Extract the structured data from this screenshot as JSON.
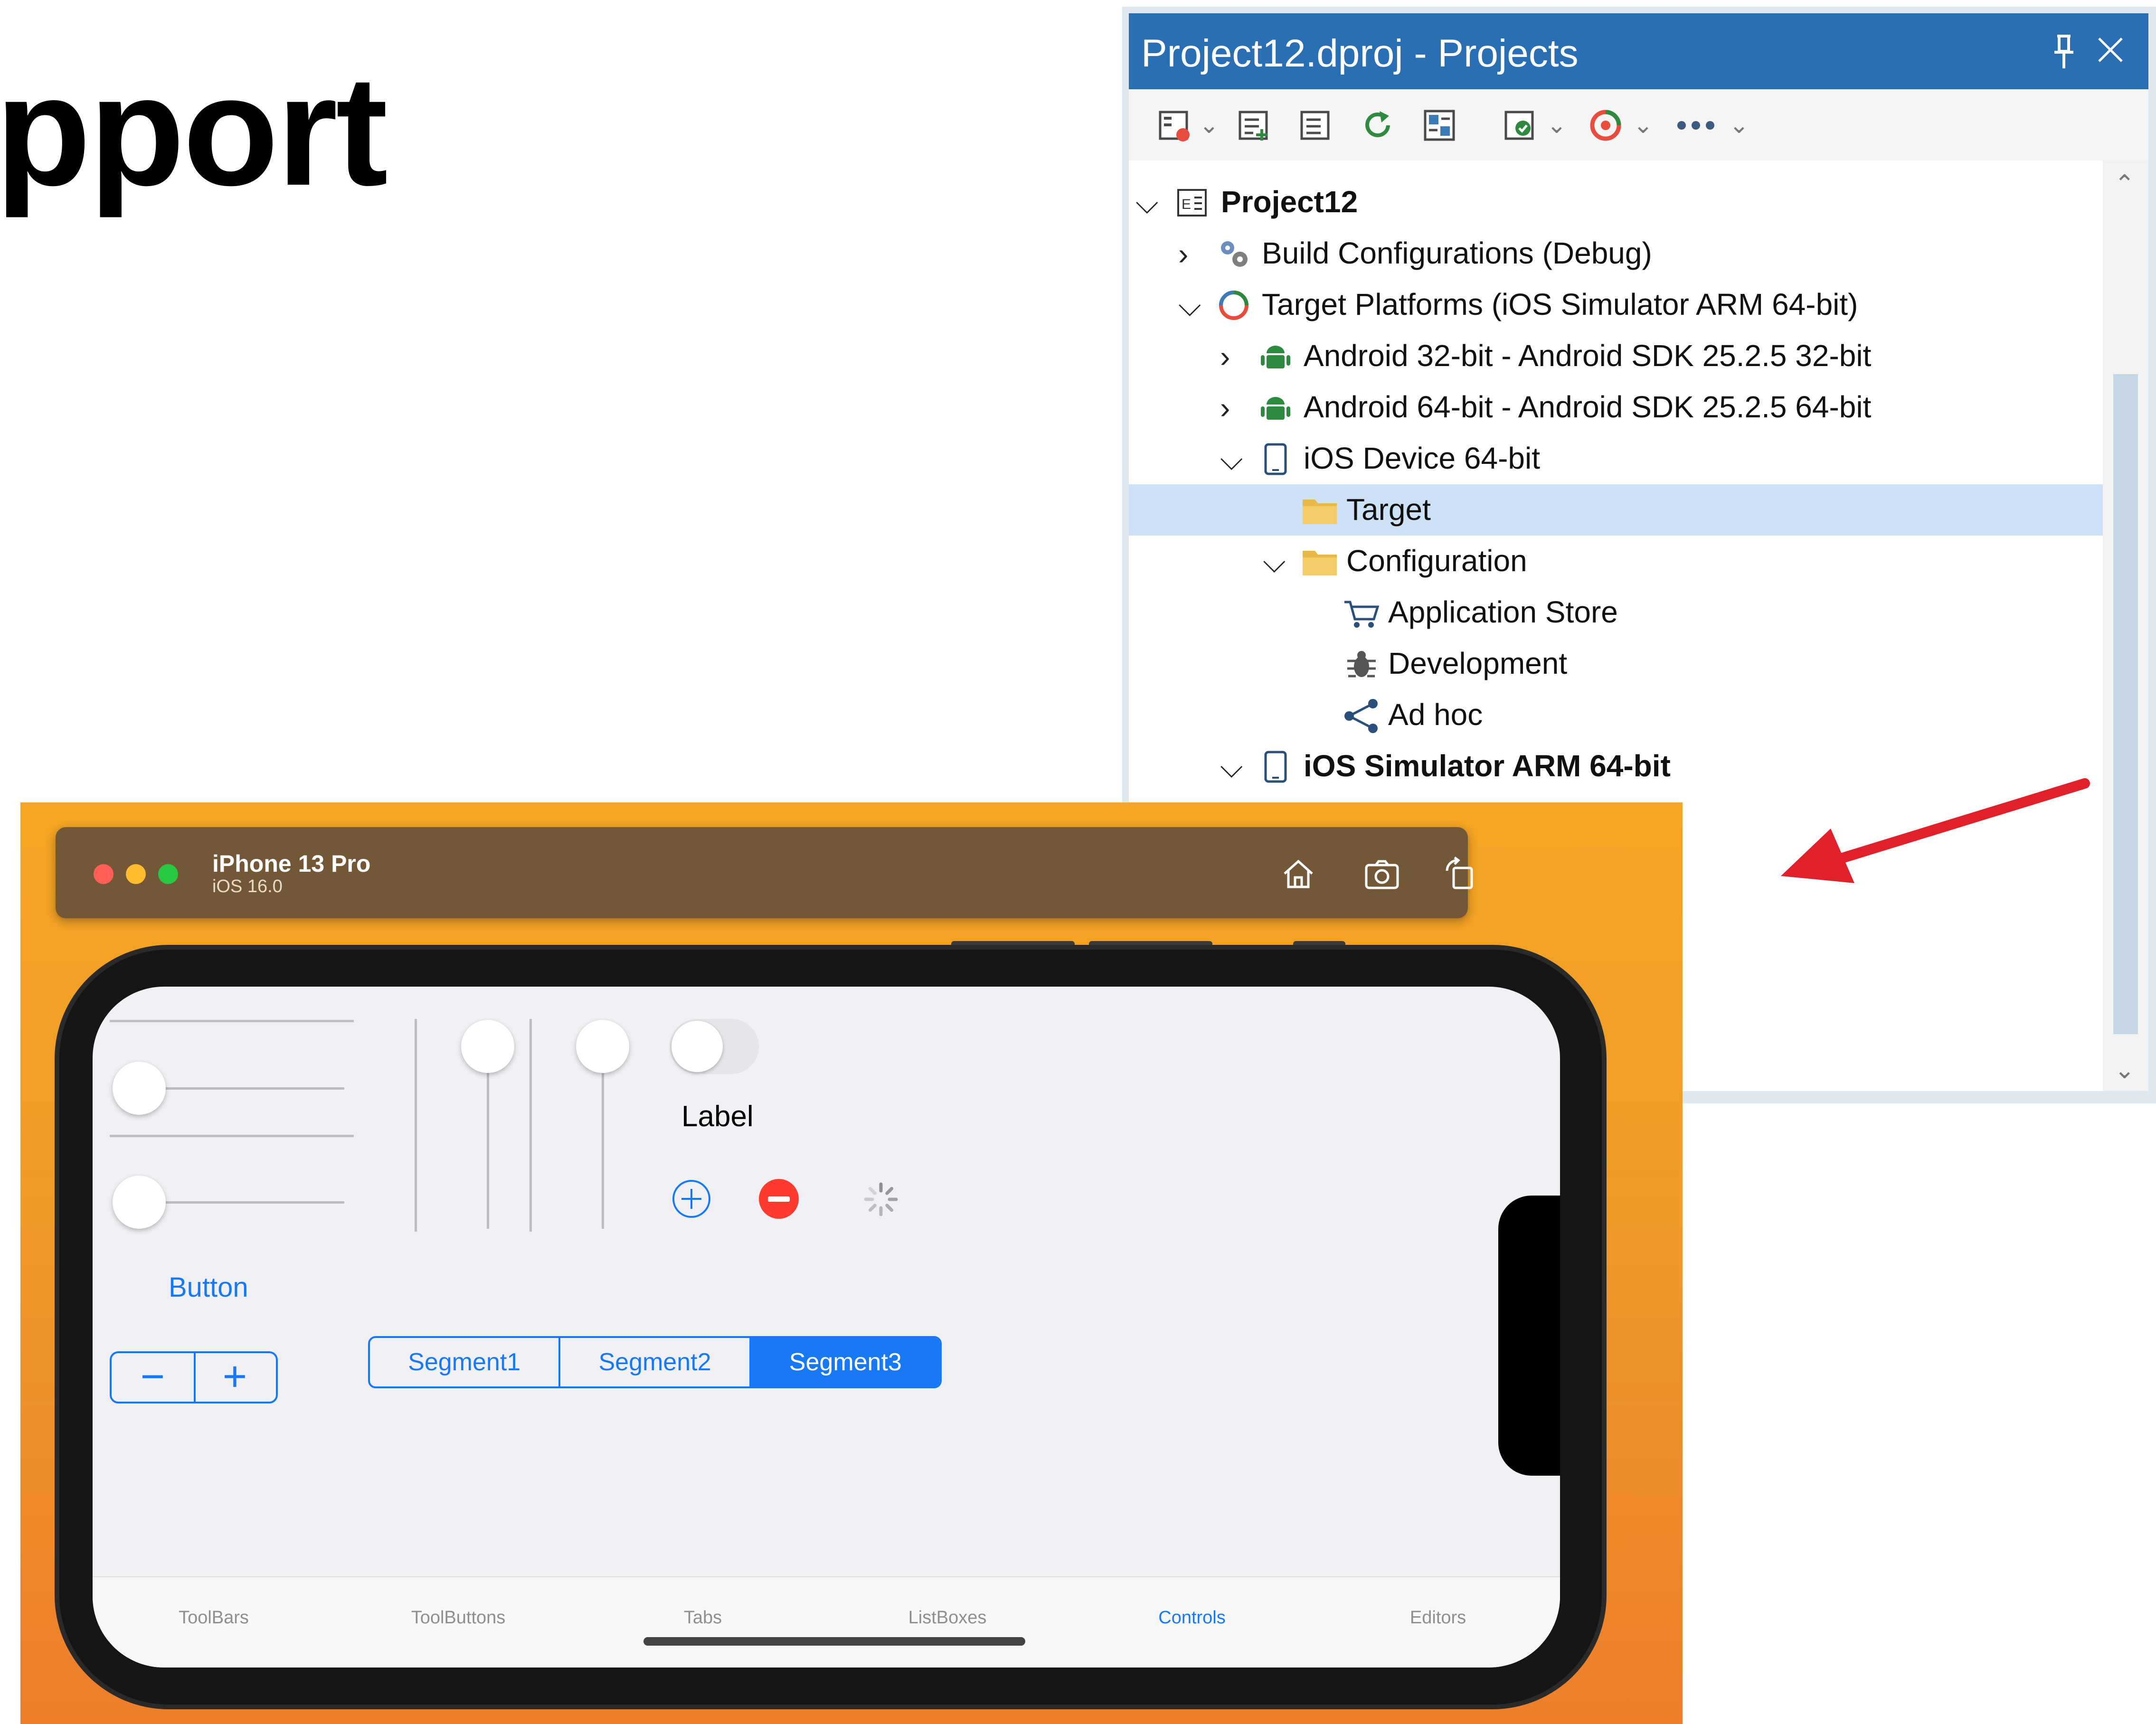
{
  "slide": {
    "title": "pport"
  },
  "projects_panel": {
    "title": "Project12.dproj - Projects",
    "pin_icon": "pin-icon",
    "close_icon": "close-icon",
    "toolbar": [
      "project-options-icon",
      "add-file-icon",
      "remove-file-icon",
      "refresh-icon",
      "build-icon",
      "activate-icon",
      "target-platform-icon",
      "more-icon"
    ],
    "tree": [
      {
        "label": "Project12",
        "bold": true,
        "expander": "expanded",
        "icon": "project-icon",
        "level": 0
      },
      {
        "label": "Build Configurations (Debug)",
        "bold": false,
        "expander": "collapsed",
        "icon": "gears-icon",
        "level": 1
      },
      {
        "label": "Target Platforms (iOS Simulator ARM 64-bit)",
        "bold": false,
        "expander": "expanded",
        "icon": "target-platforms-icon",
        "level": 1
      },
      {
        "label": "Android 32-bit - Android SDK 25.2.5 32-bit",
        "bold": false,
        "expander": "collapsed",
        "icon": "android-icon",
        "level": 2
      },
      {
        "label": "Android 64-bit - Android SDK 25.2.5 64-bit",
        "bold": false,
        "expander": "collapsed",
        "icon": "android-icon",
        "level": 2
      },
      {
        "label": "iOS Device 64-bit",
        "bold": false,
        "expander": "expanded",
        "icon": "ios-device-icon",
        "level": 2
      },
      {
        "label": "Target",
        "bold": false,
        "expander": "none",
        "icon": "folder-icon",
        "level": 3,
        "selected": true
      },
      {
        "label": "Configuration",
        "bold": false,
        "expander": "expanded",
        "icon": "folder-icon",
        "level": 3
      },
      {
        "label": "Application Store",
        "bold": false,
        "expander": "none",
        "icon": "cart-icon",
        "level": 4
      },
      {
        "label": "Development",
        "bold": false,
        "expander": "none",
        "icon": "bug-icon",
        "level": 4
      },
      {
        "label": "Ad hoc",
        "bold": false,
        "expander": "none",
        "icon": "share-icon",
        "level": 4
      },
      {
        "label": "iOS Simulator ARM 64-bit",
        "bold": true,
        "expander": "expanded",
        "icon": "ios-device-icon",
        "level": 2
      }
    ]
  },
  "simulator": {
    "device_name": "iPhone 13 Pro",
    "os_version": "iOS 16.0",
    "toolbar": [
      "home-icon",
      "screenshot-icon",
      "rotate-icon"
    ],
    "label_text": "Label",
    "button_text": "Button",
    "stepper": {
      "minus": "−",
      "plus": "+"
    },
    "segments": [
      "Segment1",
      "Segment2",
      "Segment3"
    ],
    "selected_segment": "Segment3",
    "tabs": [
      "ToolBars",
      "ToolButtons",
      "Tabs",
      "ListBoxes",
      "Controls",
      "Editors"
    ],
    "active_tab": "Controls"
  },
  "colors": {
    "panel_title_bar": "#2a6fb3",
    "selection": "#cce1f6",
    "ios_blue": "#1779f5",
    "ios_red": "#ff3b30",
    "arrow_red": "#e0202a",
    "sim_bar": "#725837"
  }
}
